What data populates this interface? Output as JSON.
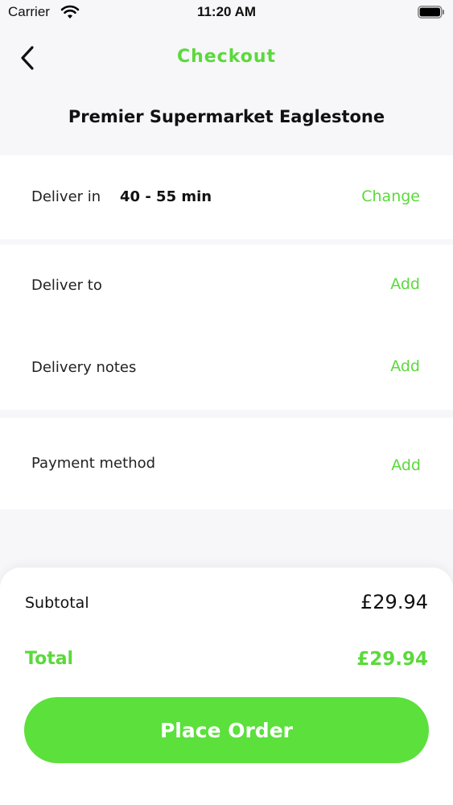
{
  "status_bar": {
    "carrier": "Carrier",
    "time": "11:20 AM"
  },
  "header": {
    "title": "Checkout",
    "back_icon": "chevron-left-icon"
  },
  "store": {
    "name": "Premier Supermarket Eaglestone"
  },
  "delivery_time": {
    "label": "Deliver in",
    "value": "40 - 55 min",
    "action": "Change"
  },
  "deliver_to": {
    "label": "Deliver to",
    "action": "Add"
  },
  "delivery_notes": {
    "label": "Delivery notes",
    "action": "Add"
  },
  "payment_method": {
    "label": "Payment method",
    "action": "Add"
  },
  "summary": {
    "subtotal_label": "Subtotal",
    "subtotal_value": "£29.94",
    "total_label": "Total",
    "total_value": "£29.94"
  },
  "place_order": {
    "label": "Place Order"
  },
  "colors": {
    "accent": "#5bd93c",
    "button": "#5be03c",
    "background": "#f7f6f9"
  }
}
